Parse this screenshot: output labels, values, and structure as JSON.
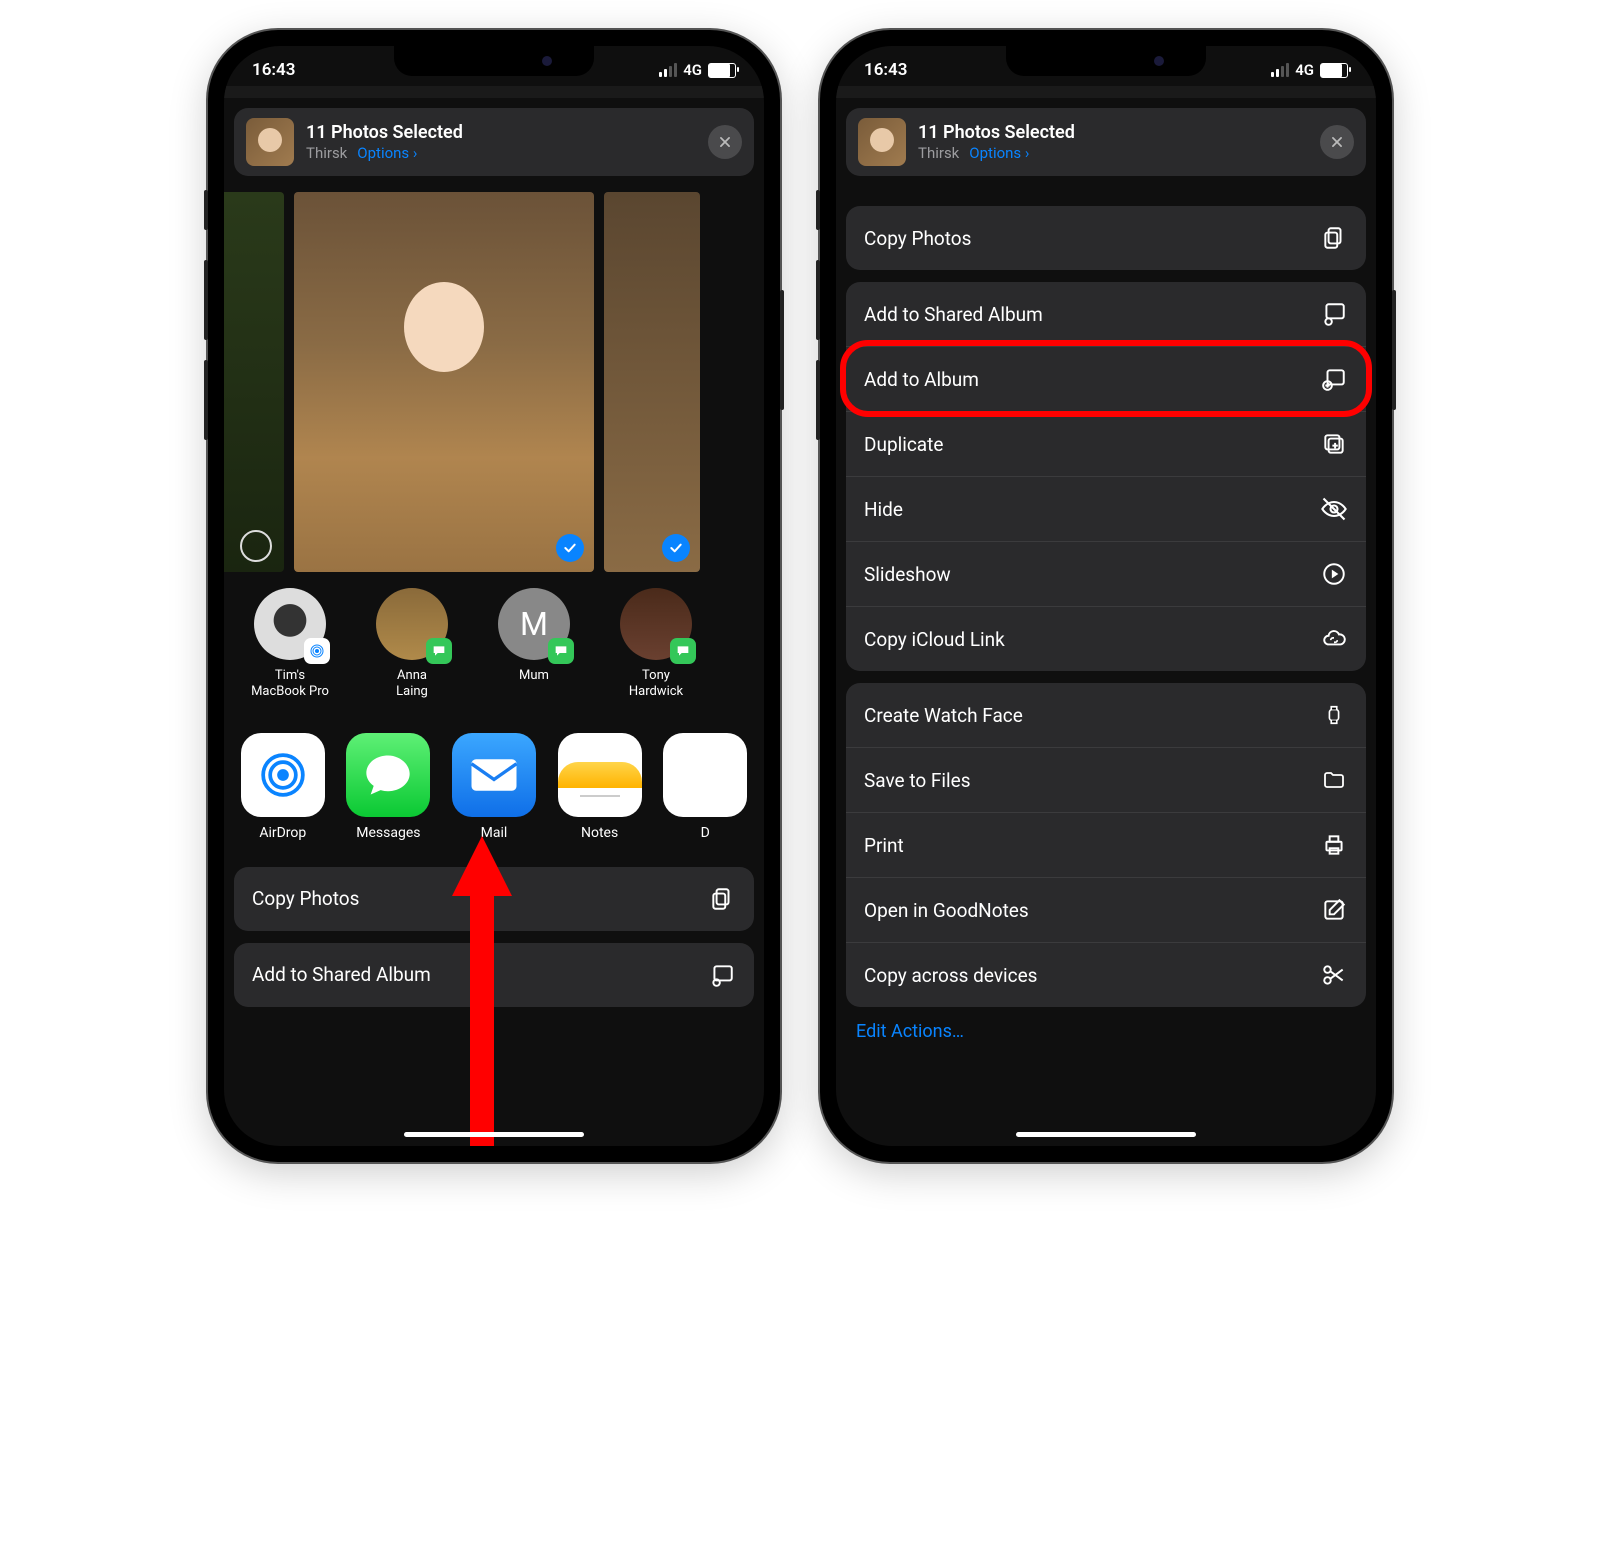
{
  "status": {
    "time": "16:43",
    "net": "4G"
  },
  "header": {
    "title": "11 Photos Selected",
    "location": "Thirsk",
    "options": "Options"
  },
  "contacts": [
    {
      "name": "Tim's\nMacBook Pro",
      "avatar": "mac",
      "badgeType": "airdrop"
    },
    {
      "name": "Anna\nLaing",
      "avatar": "anna",
      "badgeType": "msg"
    },
    {
      "name": "Mum",
      "avatar": "m",
      "letter": "M",
      "badgeType": "msg"
    },
    {
      "name": "Tony\nHardwick",
      "avatar": "tony",
      "badgeType": "msg"
    }
  ],
  "apps": [
    {
      "name": "AirDrop",
      "kind": "airdrop"
    },
    {
      "name": "Messages",
      "kind": "msg"
    },
    {
      "name": "Mail",
      "kind": "mail"
    },
    {
      "name": "Notes",
      "kind": "notes"
    },
    {
      "name": "D",
      "kind": "drive"
    }
  ],
  "left_actions": {
    "copy": "Copy Photos",
    "shared": "Add to Shared Album"
  },
  "right_actions": {
    "group1": [
      {
        "key": "copy_photos",
        "label": "Copy Photos",
        "icon": "copy"
      }
    ],
    "group2": [
      {
        "key": "add_shared",
        "label": "Add to Shared Album",
        "icon": "shared-album"
      },
      {
        "key": "add_album",
        "label": "Add to Album",
        "icon": "album",
        "highlighted": true
      },
      {
        "key": "duplicate",
        "label": "Duplicate",
        "icon": "duplicate"
      },
      {
        "key": "hide",
        "label": "Hide",
        "icon": "eye-slash"
      },
      {
        "key": "slideshow",
        "label": "Slideshow",
        "icon": "play"
      },
      {
        "key": "icloud_link",
        "label": "Copy iCloud Link",
        "icon": "link-cloud"
      }
    ],
    "group3": [
      {
        "key": "watch_face",
        "label": "Create Watch Face",
        "icon": "watch"
      },
      {
        "key": "save_files",
        "label": "Save to Files",
        "icon": "folder"
      },
      {
        "key": "print",
        "label": "Print",
        "icon": "printer"
      },
      {
        "key": "goodnotes",
        "label": "Open in GoodNotes",
        "icon": "compose"
      },
      {
        "key": "across",
        "label": "Copy across devices",
        "icon": "scissors"
      }
    ],
    "edit": "Edit Actions…"
  }
}
